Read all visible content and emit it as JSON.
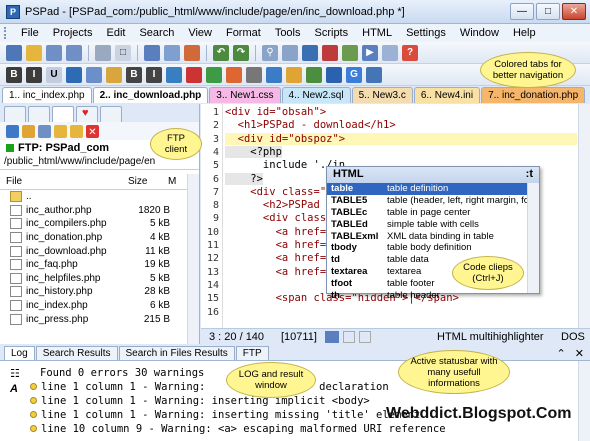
{
  "window": {
    "app_icon": "P",
    "title": "PSPad - [PSPad_com:/public_html/www/include/page/en/inc_download.php *]"
  },
  "menu": [
    "File",
    "Projects",
    "Edit",
    "Search",
    "View",
    "Format",
    "Tools",
    "Scripts",
    "HTML",
    "Settings",
    "Window",
    "Help"
  ],
  "doc_tabs": [
    {
      "label": "1.. inc_index.php",
      "color": "#ffffff"
    },
    {
      "label": "2.. inc_download.php",
      "color": "#ffffff"
    },
    {
      "label": "3.. New1.css",
      "color": "#f6b9e6"
    },
    {
      "label": "4.. New2.sql",
      "color": "#c7e6f8"
    },
    {
      "label": "5.. New3.c",
      "color": "#f3dcb0"
    },
    {
      "label": "6.. New4.ini",
      "color": "#f9e0a5"
    },
    {
      "label": "7.. inc_donation.php",
      "color": "#f5b56a"
    }
  ],
  "left": {
    "ftp_label": "FTP: PSPad_com",
    "path": "/public_html/www/include/page/en",
    "col_file": "File",
    "col_size": "Size",
    "col_m": "M",
    "files": [
      {
        "name": "..",
        "size": "",
        "folder": true
      },
      {
        "name": "inc_author.php",
        "size": "1820 B"
      },
      {
        "name": "inc_compilers.php",
        "size": "5 kB"
      },
      {
        "name": "inc_donation.php",
        "size": "4 kB"
      },
      {
        "name": "inc_download.php",
        "size": "11 kB"
      },
      {
        "name": "inc_faq.php",
        "size": "19 kB"
      },
      {
        "name": "inc_helpfiles.php",
        "size": "5 kB"
      },
      {
        "name": "inc_history.php",
        "size": "28 kB"
      },
      {
        "name": "inc_index.php",
        "size": "6 kB"
      },
      {
        "name": "inc_press.php",
        "size": "215 B"
      }
    ]
  },
  "editor": {
    "line_numbers": [
      "1",
      "2",
      "3",
      "4",
      "5",
      "6",
      "7",
      "8",
      "9",
      "10",
      "11",
      "12",
      "13",
      "14",
      "15",
      "16"
    ],
    "lines": [
      "<div id=\"obsah\">",
      "  <h1>PSPad - download</h1>",
      "  <div id=\"obspoz\">",
      "    <?php",
      "      include './in",
      "    ?>",
      "    <div class=\"dow",
      "      <h2>PSPad - c",
      "      <div class=\"l",
      "        <a href=\"<?",
      "        <a href=\"<?",
      "        <a href=\"<?",
      "        <a href=\"<?",
      "",
      "        <span class=\"hidden\">|</span>",
      ""
    ],
    "status_pos": "3 : 20 / 140",
    "status_code": "[10711]",
    "status_hl": "HTML multihighlighter",
    "status_eol": "DOS"
  },
  "popup": {
    "title": "HTML",
    "suffix": ":t",
    "rows": [
      {
        "k": "table",
        "d": "table definition"
      },
      {
        "k": "TABLE5",
        "d": "table (header, left, right margin, fo"
      },
      {
        "k": "TABLEc",
        "d": "table in page center"
      },
      {
        "k": "TABLEd",
        "d": "simple table with cells"
      },
      {
        "k": "TABLExml",
        "d": "XML data binding in table"
      },
      {
        "k": "tbody",
        "d": "table body definition"
      },
      {
        "k": "td",
        "d": "table data"
      },
      {
        "k": "textarea",
        "d": "textarea"
      },
      {
        "k": "tfoot",
        "d": "table footer"
      },
      {
        "k": "th",
        "d": "table header"
      }
    ]
  },
  "bottom": {
    "tabs": [
      "Log",
      "Search Results",
      "Search in Files Results",
      "FTP"
    ],
    "log": [
      "Found 0 errors 30 warnings",
      "line 1 column 1 - Warning:              PE> declaration",
      "line 1 column 1 - Warning: inserting implicit <body>",
      "line 1 column 1 - Warning: inserting missing 'title' element",
      "line 10 column 9 - Warning: <a> escaping malformed URI reference"
    ]
  },
  "callouts": {
    "tabs": "Colored tabs for better navigation",
    "ftp": "FTP client",
    "clips": "Code clieps (Ctrl+J)",
    "status": "Active statusbar with many usefull informations",
    "log": "LOG and result window"
  },
  "watermark": "Webddict.Blogspot.Com",
  "icons": [
    "app-icon",
    "minimize-icon",
    "maximize-icon",
    "close-icon",
    "folder-icon",
    "file-icon",
    "ftp-icon",
    "heart-icon",
    "scroll-arrow-icon",
    "log-icon",
    "font-icon"
  ]
}
